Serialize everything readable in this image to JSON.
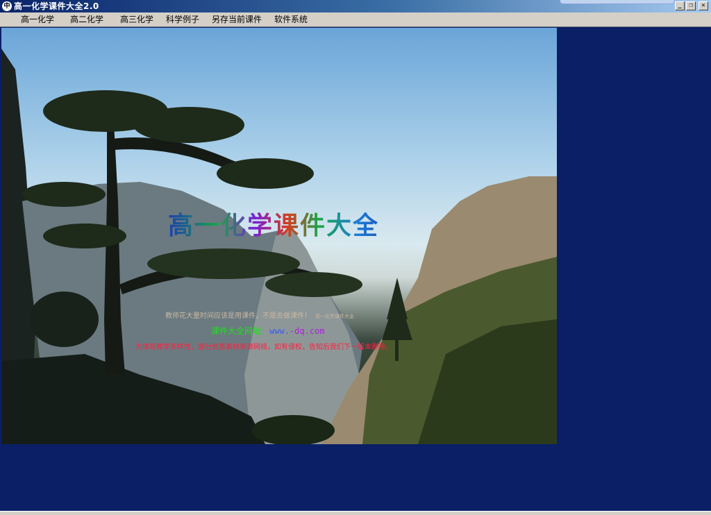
{
  "window": {
    "title": "高一化学课件大全2.0",
    "app_icon_glyph": "中",
    "controls": {
      "minimize": "_",
      "maximize": "❐",
      "close": "✕"
    }
  },
  "menu": {
    "items": [
      {
        "label": "高一化学"
      },
      {
        "label": "高二化学"
      },
      {
        "label": "高三化学"
      },
      {
        "label": "科学例子"
      },
      {
        "label": "另存当前课件"
      },
      {
        "label": "软件系统"
      }
    ]
  },
  "splash": {
    "title": "高一化学课件大全",
    "subtitle": "教师花大量时间应该是用课件，不是去做课件！",
    "subtitle_small": "高一化学课件大全",
    "website_prefix": "课件",
    "website_mid": "大全网址：",
    "website_domain": "www.",
    "website_suffix": "-dq.com",
    "notice": "为体现教学多样性，部分信息素材来源网络，如有侵权，告知后我们下一版本删除。"
  },
  "colors": {
    "background": "#0a1f66",
    "menubar": "#d4d0c8",
    "notice": "#ff2040",
    "website_green": "#22dd22"
  }
}
